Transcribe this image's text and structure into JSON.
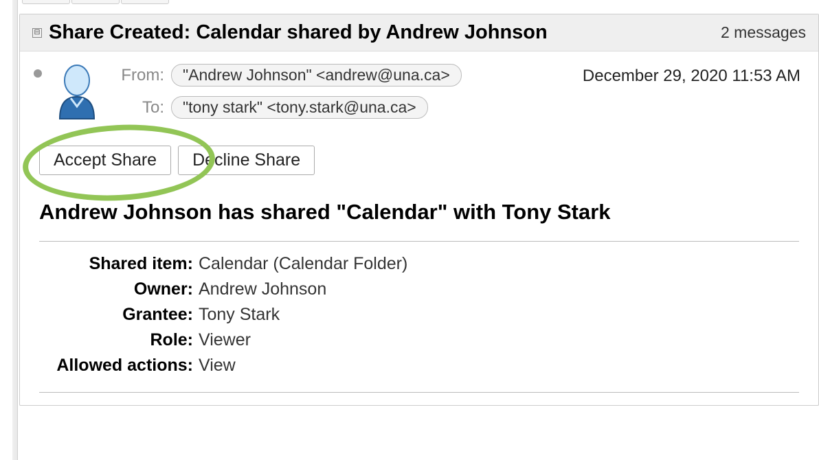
{
  "subject": "Share Created: Calendar shared by Andrew Johnson",
  "message_count": "2 messages",
  "from_label": "From:",
  "to_label": "To:",
  "from_value": "\"Andrew Johnson\" <andrew@una.ca>",
  "to_value": "\"tony stark\" <tony.stark@una.ca>",
  "timestamp": "December 29, 2020 11:53 AM",
  "accept_label": "Accept Share",
  "decline_label": "Decline Share",
  "body_heading": "Andrew Johnson has shared \"Calendar\" with Tony Stark",
  "details": {
    "shared_item_label": "Shared item:",
    "shared_item_value": "Calendar (Calendar Folder)",
    "owner_label": "Owner:",
    "owner_value": "Andrew Johnson",
    "grantee_label": "Grantee:",
    "grantee_value": "Tony Stark",
    "role_label": "Role:",
    "role_value": "Viewer",
    "allowed_label": "Allowed actions:",
    "allowed_value": "View"
  }
}
